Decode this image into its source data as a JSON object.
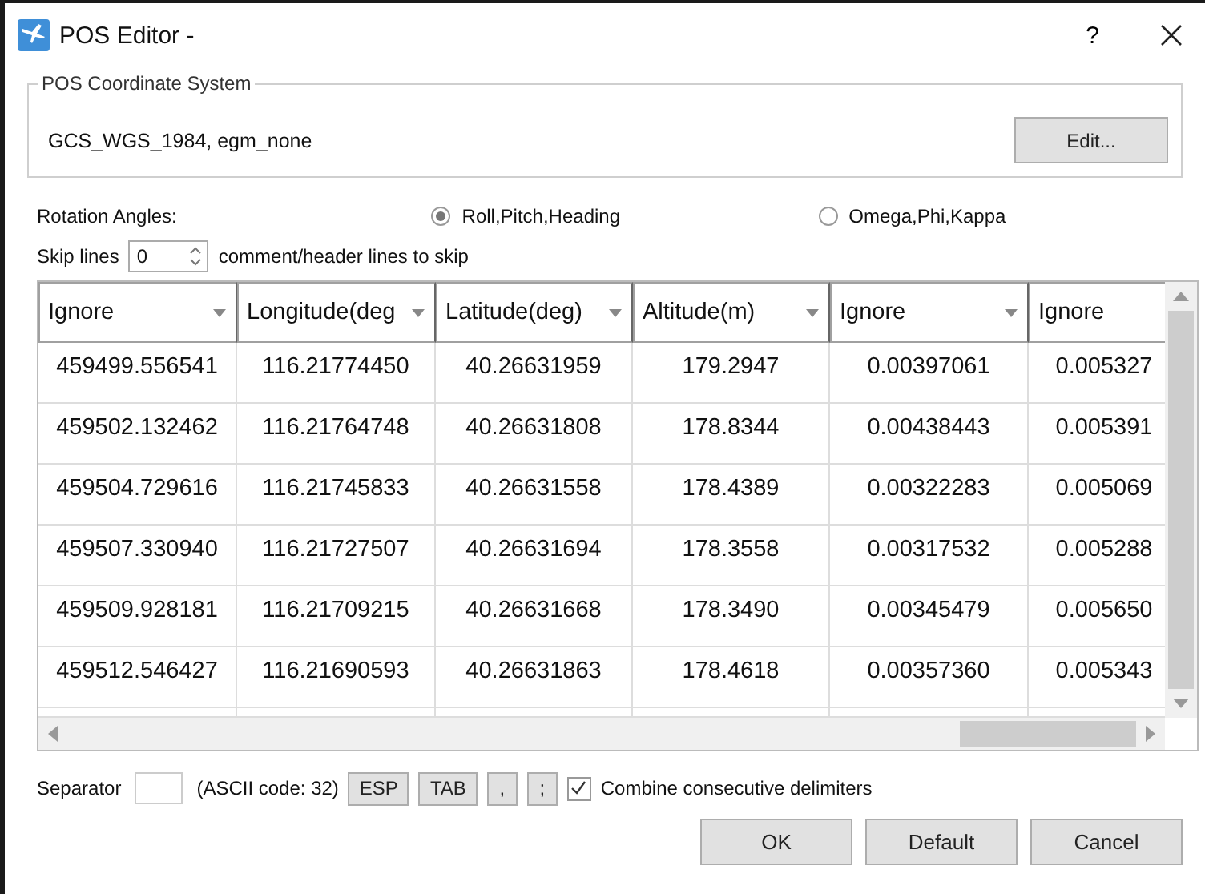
{
  "window": {
    "title": "POS Editor -",
    "help": "?"
  },
  "coordinate_system": {
    "legend": "POS Coordinate System",
    "value": "GCS_WGS_1984, egm_none",
    "edit_button": "Edit..."
  },
  "rotation": {
    "label": "Rotation Angles:",
    "options": [
      {
        "label": "Roll,Pitch,Heading",
        "selected": true
      },
      {
        "label": "Omega,Phi,Kappa",
        "selected": false
      }
    ]
  },
  "skip_lines": {
    "label": "Skip lines",
    "value": "0",
    "suffix": "comment/header lines to skip"
  },
  "table": {
    "columns": [
      "Ignore",
      "Longitude(deg",
      "Latitude(deg)",
      "Altitude(m)",
      "Ignore",
      "Ignore"
    ],
    "rows": [
      [
        "459499.556541",
        "116.21774450",
        "40.26631959",
        "179.2947",
        "0.00397061",
        "0.005327"
      ],
      [
        "459502.132462",
        "116.21764748",
        "40.26631808",
        "178.8344",
        "0.00438443",
        "0.005391"
      ],
      [
        "459504.729616",
        "116.21745833",
        "40.26631558",
        "178.4389",
        "0.00322283",
        "0.005069"
      ],
      [
        "459507.330940",
        "116.21727507",
        "40.26631694",
        "178.3558",
        "0.00317532",
        "0.005288"
      ],
      [
        "459509.928181",
        "116.21709215",
        "40.26631668",
        "178.3490",
        "0.00345479",
        "0.005650"
      ],
      [
        "459512.546427",
        "116.21690593",
        "40.26631863",
        "178.4618",
        "0.00357360",
        "0.005343"
      ]
    ]
  },
  "separator": {
    "label": "Separator",
    "ascii": "(ASCII code: 32)",
    "buttons": [
      "ESP",
      "TAB",
      ",",
      ";"
    ],
    "combine": {
      "label": "Combine consecutive delimiters",
      "checked": true
    }
  },
  "buttons": [
    "OK",
    "Default",
    "Cancel"
  ]
}
